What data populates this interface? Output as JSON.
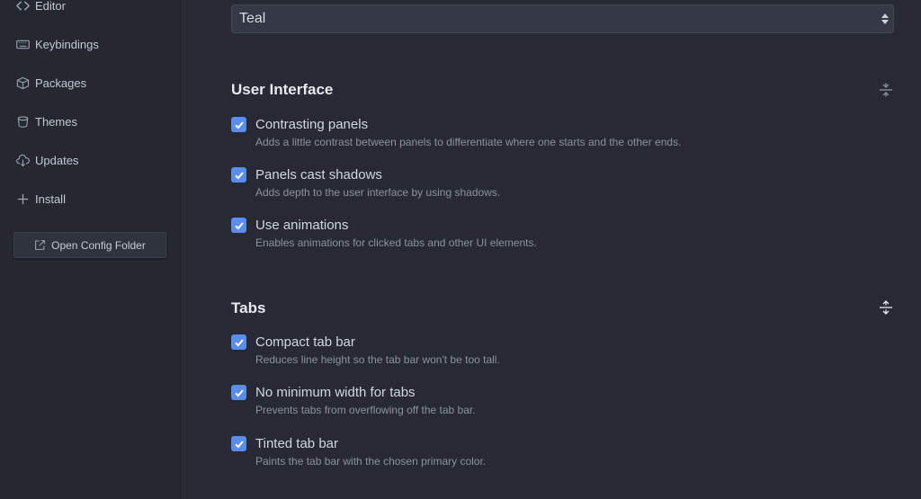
{
  "sidebar": {
    "items": [
      {
        "label": "Editor",
        "icon": "code-icon"
      },
      {
        "label": "Keybindings",
        "icon": "keyboard-icon"
      },
      {
        "label": "Packages",
        "icon": "package-icon"
      },
      {
        "label": "Themes",
        "icon": "paintcan-icon"
      },
      {
        "label": "Updates",
        "icon": "cloud-download-icon"
      },
      {
        "label": "Install",
        "icon": "plus-icon"
      }
    ],
    "config_button": "Open Config Folder"
  },
  "main": {
    "select_value": "Teal",
    "sections": [
      {
        "title": "User Interface",
        "options": [
          {
            "label": "Contrasting panels",
            "description": "Adds a little contrast between panels to differentiate where one starts and the other ends.",
            "checked": true
          },
          {
            "label": "Panels cast shadows",
            "description": "Adds depth to the user interface by using shadows.",
            "checked": true
          },
          {
            "label": "Use animations",
            "description": "Enables animations for clicked tabs and other UI elements.",
            "checked": true
          }
        ]
      },
      {
        "title": "Tabs",
        "options": [
          {
            "label": "Compact tab bar",
            "description": "Reduces line height so the tab bar won't be too tall.",
            "checked": true
          },
          {
            "label": "No minimum width for tabs",
            "description": "Prevents tabs from overflowing off the tab bar.",
            "checked": true
          },
          {
            "label": "Tinted tab bar",
            "description": "Paints the tab bar with the chosen primary color.",
            "checked": true
          }
        ]
      }
    ]
  },
  "colors": {
    "background": "#272a34",
    "sidebar": "#252831",
    "accent": "#5b8def"
  }
}
